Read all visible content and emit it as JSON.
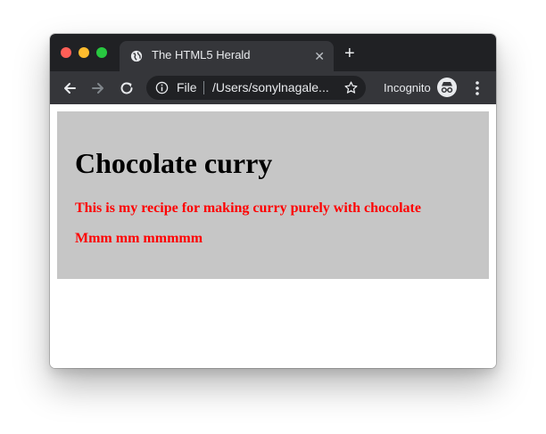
{
  "browser": {
    "tab": {
      "title": "The HTML5 Herald",
      "favicon": "globe-icon",
      "close_icon": "close-icon"
    },
    "new_tab_icon": "plus-icon",
    "toolbar": {
      "back_icon": "back-arrow-icon",
      "forward_icon": "forward-arrow-icon",
      "reload_icon": "reload-icon",
      "omnibox": {
        "info_icon": "info-icon",
        "scheme": "File",
        "url": "/Users/sonylnagale...",
        "star_icon": "star-icon"
      },
      "incognito_label": "Incognito",
      "incognito_icon": "incognito-icon",
      "menu_icon": "kebab-menu-icon"
    }
  },
  "page": {
    "heading": "Chocolate curry",
    "paragraphs": [
      "This is my recipe for making curry purely with chocolate",
      "Mmm mm mmmmm"
    ]
  },
  "colors": {
    "content_background": "#c6c6c6",
    "paragraph_text": "#ff0000",
    "heading_text": "#000000",
    "tabstrip": "#202124",
    "toolbar": "#35363a"
  }
}
